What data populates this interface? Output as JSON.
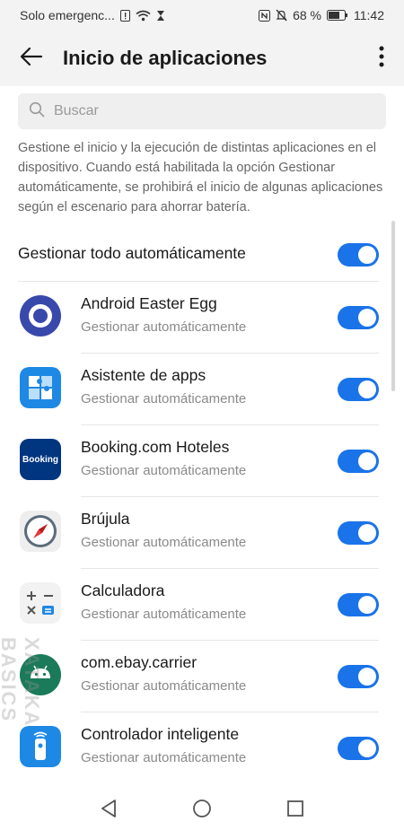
{
  "status_bar": {
    "carrier": "Solo emergenc...",
    "battery": "68 %",
    "time": "11:42"
  },
  "header": {
    "title": "Inicio de aplicaciones",
    "back_icon": "arrow-left-icon",
    "more_icon": "more-vert-icon"
  },
  "search": {
    "placeholder": "Buscar"
  },
  "description": "Gestione el inicio y la ejecución de distintas aplicaciones en el dispositivo. Cuando está habilitada la opción Gestionar automáticamente, se prohibirá el inicio de algunas aplicaciones según el escenario para ahorrar batería.",
  "master": {
    "label": "Gestionar todo automáticamente",
    "enabled": true
  },
  "apps": [
    {
      "name": "Android Easter Egg",
      "status": "Gestionar automáticamente",
      "icon": "android-easter-egg-icon",
      "enabled": true
    },
    {
      "name": "Asistente de apps",
      "status": "Gestionar automáticamente",
      "icon": "puzzle-icon",
      "enabled": true
    },
    {
      "name": "Booking.com Hoteles",
      "status": "Gestionar automáticamente",
      "icon": "booking-icon",
      "icon_text": "Booking",
      "enabled": true
    },
    {
      "name": "Brújula",
      "status": "Gestionar automáticamente",
      "icon": "compass-icon",
      "enabled": true
    },
    {
      "name": "Calculadora",
      "status": "Gestionar automáticamente",
      "icon": "calculator-icon",
      "enabled": true
    },
    {
      "name": "com.ebay.carrier",
      "status": "Gestionar automáticamente",
      "icon": "android-robot-icon",
      "enabled": true
    },
    {
      "name": "Controlador inteligente",
      "status": "Gestionar automáticamente",
      "icon": "remote-control-icon",
      "enabled": true
    }
  ],
  "colors": {
    "accent": "#1a73e8",
    "bar_bg": "#f3f3f3"
  },
  "watermark": "XATAKA BASICS"
}
